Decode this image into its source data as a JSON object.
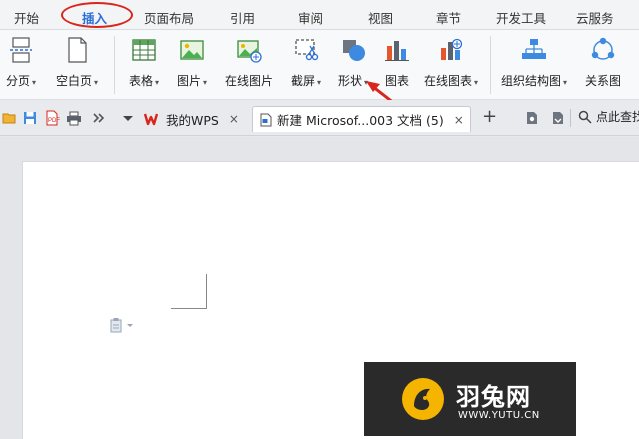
{
  "menu": {
    "tabs": [
      "开始",
      "插入",
      "页面布局",
      "引用",
      "审阅",
      "视图",
      "章节",
      "开发工具",
      "云服务"
    ],
    "active": "插入"
  },
  "ribbon": {
    "buttons": [
      {
        "label": "分页",
        "icon": "page-break-icon",
        "dropdown": true
      },
      {
        "label": "空白页",
        "icon": "blank-page-icon",
        "dropdown": true
      },
      {
        "label": "表格",
        "icon": "table-icon",
        "dropdown": true
      },
      {
        "label": "图片",
        "icon": "picture-icon",
        "dropdown": true
      },
      {
        "label": "在线图片",
        "icon": "online-picture-icon",
        "dropdown": false
      },
      {
        "label": "截屏",
        "icon": "screenshot-icon",
        "dropdown": true
      },
      {
        "label": "形状",
        "icon": "shapes-icon",
        "dropdown": true
      },
      {
        "label": "图表",
        "icon": "chart-icon",
        "dropdown": false
      },
      {
        "label": "在线图表",
        "icon": "online-chart-icon",
        "dropdown": true
      },
      {
        "label": "组织结构图",
        "icon": "org-chart-icon",
        "dropdown": true
      },
      {
        "label": "关系图",
        "icon": "relationship-chart-icon",
        "dropdown": false
      }
    ],
    "dropdown_glyph": "▾"
  },
  "tabbar": {
    "tabs": [
      {
        "label": "我的WPS",
        "close": "×"
      },
      {
        "label": "新建 Microsof...003 文档 (5)",
        "close": "×"
      }
    ],
    "new_tab_glyph": "+",
    "search_label": "点此查找"
  },
  "watermark": {
    "title": "羽兔网",
    "url": "WWW.YUTU.CN"
  },
  "colors": {
    "accent": "#2b6fd6",
    "annotation_red": "#d9261c"
  }
}
